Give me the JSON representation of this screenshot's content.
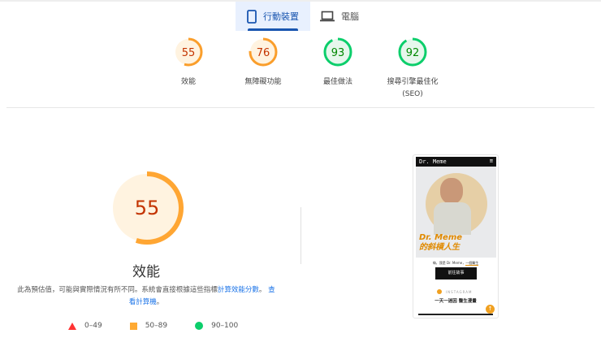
{
  "tabs": [
    {
      "label": "行動裝置",
      "icon": "smartphone-icon"
    },
    {
      "label": "電腦",
      "icon": "laptop-icon"
    }
  ],
  "gauges": [
    {
      "score": 55,
      "label": "效能",
      "color": "#fa9e2b",
      "text": "#c33300",
      "bg": "#fff3e0"
    },
    {
      "score": 76,
      "label": "無障礙功能",
      "color": "#fa9e2b",
      "text": "#c33300",
      "bg": "#fff3e0"
    },
    {
      "score": 93,
      "label": "最佳做法",
      "color": "#0cce6b",
      "text": "#008800",
      "bg": "#e6f7ec"
    },
    {
      "score": 92,
      "label": "搜尋引擎最佳化",
      "label2": "(SEO)",
      "color": "#0cce6b",
      "text": "#008800",
      "bg": "#e6f7ec"
    }
  ],
  "main": {
    "score": 55,
    "title": "效能",
    "desc": "此為預估值，可能與實際情況有所不同。系統會直接根據這些指標",
    "link1": "計算效能分數",
    "sep": "。",
    "link2": "查看計算機",
    "end": "。"
  },
  "legend": [
    {
      "range": "0–49",
      "color": "#ff3333"
    },
    {
      "range": "50–89",
      "color": "#ffaa33"
    },
    {
      "range": "90–100",
      "color": "#0cce6b"
    }
  ],
  "phone": {
    "brand": "Dr. Meme",
    "headline1": "Dr. Meme",
    "headline2": "的斜槓人生",
    "intro": "嗨，我是 Dr. Meme，",
    "intro_link": "一個醫生",
    "button": "前往故事",
    "instagram": "INSTAGRAM",
    "tagline": "一天一迷因 醫生漫畫"
  }
}
